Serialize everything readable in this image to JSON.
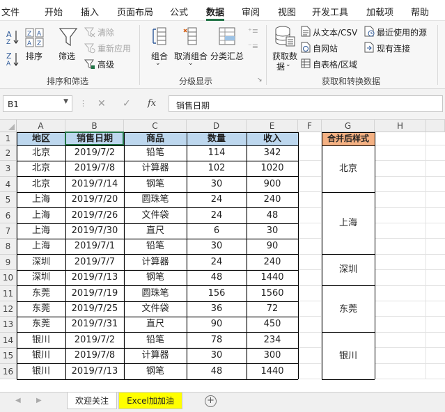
{
  "menu": {
    "tabs": [
      "文件",
      "开始",
      "插入",
      "页面布局",
      "公式",
      "数据",
      "审阅",
      "视图",
      "开发工具",
      "加载项",
      "帮助"
    ],
    "active": "数据"
  },
  "ribbon": {
    "sort_filter": {
      "sort_label": "排序",
      "filter_label": "筛选",
      "clear_label": "清除",
      "reapply_label": "重新应用",
      "advanced_label": "高级",
      "group_label": "排序和筛选"
    },
    "outline": {
      "group_btn": "组合",
      "ungroup_btn": "取消组合",
      "subtotal_btn": "分类汇总",
      "group_label": "分级显示"
    },
    "get_data": {
      "get_data_line1": "获取数",
      "get_data_line2": "据",
      "from_text": "从文本/CSV",
      "from_web": "自网站",
      "from_table": "自表格/区域",
      "recent_sources": "最近使用的源",
      "existing_connections": "现有连接",
      "group_label": "获取和转换数据"
    }
  },
  "formula_bar": {
    "name_box": "B1",
    "cancel_symbol": "✕",
    "enter_symbol": "✓",
    "fx_label": "fx",
    "content": "销售日期"
  },
  "sheet": {
    "columns": [
      "A",
      "B",
      "C",
      "D",
      "E",
      "F",
      "G",
      "H"
    ],
    "rows": [
      "1",
      "2",
      "3",
      "4",
      "5",
      "6",
      "7",
      "8",
      "9",
      "10",
      "11",
      "12",
      "13",
      "14",
      "15",
      "16"
    ],
    "headers": [
      "地区",
      "销售日期",
      "商品",
      "数量",
      "收入"
    ],
    "data": [
      [
        "北京",
        "2019/7/2",
        "铅笔",
        "114",
        "342"
      ],
      [
        "北京",
        "2019/7/8",
        "计算器",
        "102",
        "1020"
      ],
      [
        "北京",
        "2019/7/14",
        "钢笔",
        "30",
        "900"
      ],
      [
        "上海",
        "2019/7/20",
        "圆珠笔",
        "24",
        "240"
      ],
      [
        "上海",
        "2019/7/26",
        "文件袋",
        "24",
        "48"
      ],
      [
        "上海",
        "2019/7/30",
        "直尺",
        "6",
        "30"
      ],
      [
        "上海",
        "2019/7/1",
        "铅笔",
        "30",
        "90"
      ],
      [
        "深圳",
        "2019/7/7",
        "计算器",
        "24",
        "240"
      ],
      [
        "深圳",
        "2019/7/13",
        "钢笔",
        "48",
        "1440"
      ],
      [
        "东莞",
        "2019/7/19",
        "圆珠笔",
        "156",
        "1560"
      ],
      [
        "东莞",
        "2019/7/25",
        "文件袋",
        "36",
        "72"
      ],
      [
        "东莞",
        "2019/7/31",
        "直尺",
        "90",
        "450"
      ],
      [
        "银川",
        "2019/7/2",
        "铅笔",
        "78",
        "234"
      ],
      [
        "银川",
        "2019/7/8",
        "计算器",
        "30",
        "300"
      ],
      [
        "银川",
        "2019/7/13",
        "钢笔",
        "48",
        "1440"
      ]
    ],
    "merged_header": "合并后样式",
    "merged_groups": [
      {
        "label": "北京",
        "rows": 3
      },
      {
        "label": "上海",
        "rows": 4
      },
      {
        "label": "深圳",
        "rows": 2
      },
      {
        "label": "东莞",
        "rows": 3
      },
      {
        "label": "银川",
        "rows": 3
      }
    ]
  },
  "sheet_tabs": [
    "欢迎关注",
    "Excel加加油"
  ],
  "colors": {
    "header_fill": "#bdd7ee",
    "merged_header_fill": "#f4b183",
    "active_tab_fill": "#ffff00",
    "excel_green": "#217346"
  }
}
